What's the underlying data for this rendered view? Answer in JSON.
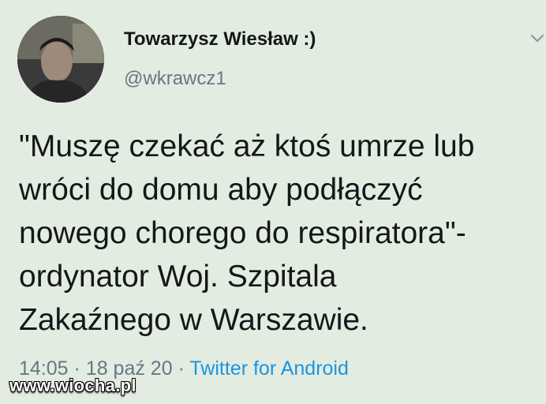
{
  "tweet": {
    "author": {
      "display_name": "Towarzysz Wiesław :)",
      "handle": "@wkrawcz1"
    },
    "text_lines": [
      "\"Muszę czekać aż ktoś umrze lub",
      "wróci do domu aby podłączyć",
      "nowego chorego do respiratora\"-",
      "ordynator Woj. Szpitala",
      "Zakaźnego w Warszawie."
    ],
    "time": "14:05",
    "date": "18 paź 20",
    "source": "Twitter for Android",
    "separator": "·"
  },
  "watermark": "www.wiocha.pl",
  "colors": {
    "background": "#e3ece0",
    "text": "#14171a",
    "muted": "#657786",
    "link": "#1b95e0"
  }
}
